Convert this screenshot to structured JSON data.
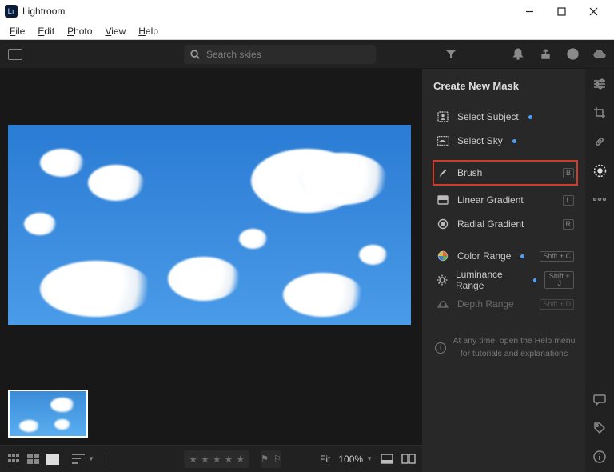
{
  "titlebar": {
    "title": "Lightroom"
  },
  "menubar": {
    "items": [
      "File",
      "Edit",
      "Photo",
      "View",
      "Help"
    ]
  },
  "topbar": {
    "search_placeholder": "Search skies"
  },
  "panel": {
    "title": "Create New Mask",
    "items": [
      {
        "label": "Select Subject",
        "dot": true,
        "shortcut": ""
      },
      {
        "label": "Select Sky",
        "dot": true,
        "shortcut": ""
      },
      {
        "label": "Brush",
        "dot": false,
        "shortcut": "B"
      },
      {
        "label": "Linear Gradient",
        "dot": false,
        "shortcut": "L"
      },
      {
        "label": "Radial Gradient",
        "dot": false,
        "shortcut": "R"
      },
      {
        "label": "Color Range",
        "dot": true,
        "shortcut": "Shift + C"
      },
      {
        "label": "Luminance Range",
        "dot": true,
        "shortcut": "Shift + J"
      },
      {
        "label": "Depth Range",
        "dot": false,
        "shortcut": "Shift + D"
      }
    ],
    "hint": "At any time, open the Help menu for tutorials and explanations"
  },
  "bottombar": {
    "fit_label": "Fit",
    "zoom": "100%"
  }
}
